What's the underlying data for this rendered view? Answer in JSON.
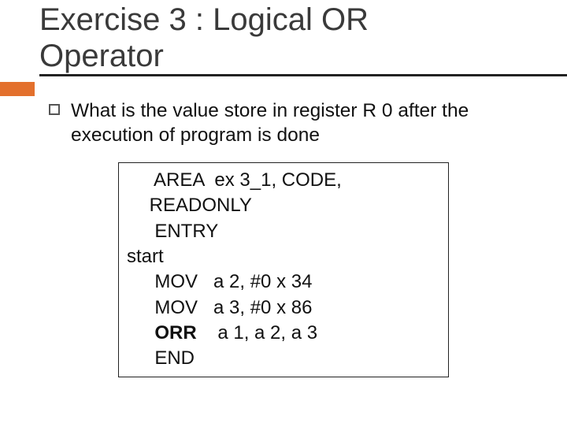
{
  "title": "Exercise 3 : Logical OR Operator",
  "question": "What is the value store in register R 0 after the execution of program is done",
  "code": {
    "l1a": "  AREA  ex 3_1, CODE,",
    "l1b": " READONLY",
    "l2": "  ENTRY",
    "l3": "start",
    "l4": "  MOV   a 2, #0 x 34",
    "l5": "  MOV   a 3, #0 x 86",
    "l6_op": "  ORR",
    "l6_args": "    a 1, a 2, a 3",
    "l7": "  END"
  }
}
